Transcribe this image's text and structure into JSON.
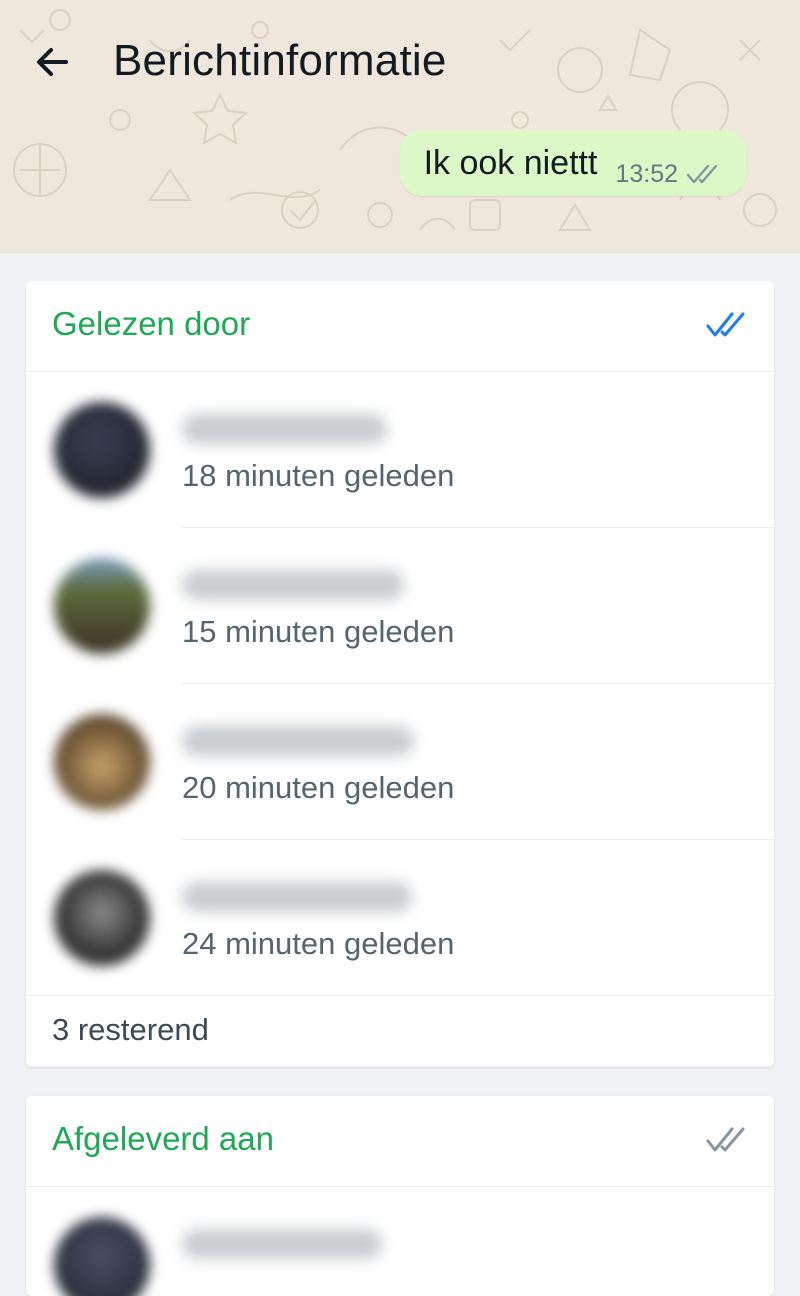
{
  "header": {
    "title": "Berichtinformatie",
    "back_icon": "arrow-left-icon"
  },
  "message": {
    "text": "Ik ook niettt",
    "time": "13:52",
    "status_icon": "double-check-icon"
  },
  "read_section": {
    "title": "Gelezen door",
    "check_color": "#1a7cf0",
    "readers": [
      {
        "time_ago": "18 minuten geleden"
      },
      {
        "time_ago": "15 minuten geleden"
      },
      {
        "time_ago": "20 minuten geleden"
      },
      {
        "time_ago": "24 minuten geleden"
      }
    ],
    "remaining": "3 resterend"
  },
  "delivered_section": {
    "title": "Afgeleverd aan",
    "check_color": "#8696a0"
  },
  "colors": {
    "accent_green": "#1fa855",
    "bubble": "#dcf8c6",
    "read_blue": "#1a7cf0"
  }
}
